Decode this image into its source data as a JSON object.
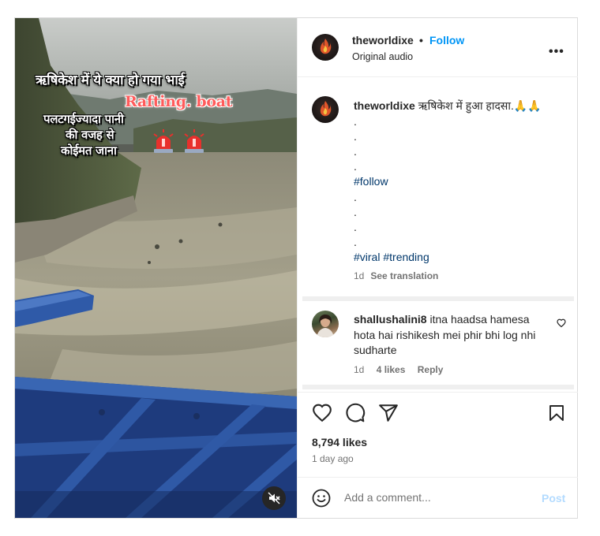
{
  "post": {
    "overlay": {
      "line1": "ऋषिकेश में ये क्या हो गया भाई",
      "line2": "Rafting. boat",
      "line3": "पलटगईज्यादा पानी",
      "line4": "की वजह से",
      "line5": "कोईमत जाना"
    },
    "header": {
      "username": "theworldixe",
      "separator": "•",
      "follow_label": "Follow",
      "audio": "Original audio",
      "more_label": "•••"
    },
    "caption": {
      "username": "theworldixe",
      "text": "ऋषिकेश में हुआ हादसा.🙏🙏",
      "dot": ".",
      "hashtag_follow": "#follow",
      "hashtag_viral": "#viral",
      "hashtag_trending": "#trending",
      "time": "1d",
      "see_translation": "See translation"
    },
    "comment": {
      "username": "shallushalini8",
      "text": "itna haadsa hamesa hota hai rishikesh mei phir bhi log nhi sudharte",
      "time": "1d",
      "likes": "4 likes",
      "reply": "Reply"
    },
    "stats": {
      "likes": "8,794 likes",
      "posted": "1 day ago"
    },
    "add_comment": {
      "placeholder": "Add a comment...",
      "post_label": "Post"
    }
  }
}
